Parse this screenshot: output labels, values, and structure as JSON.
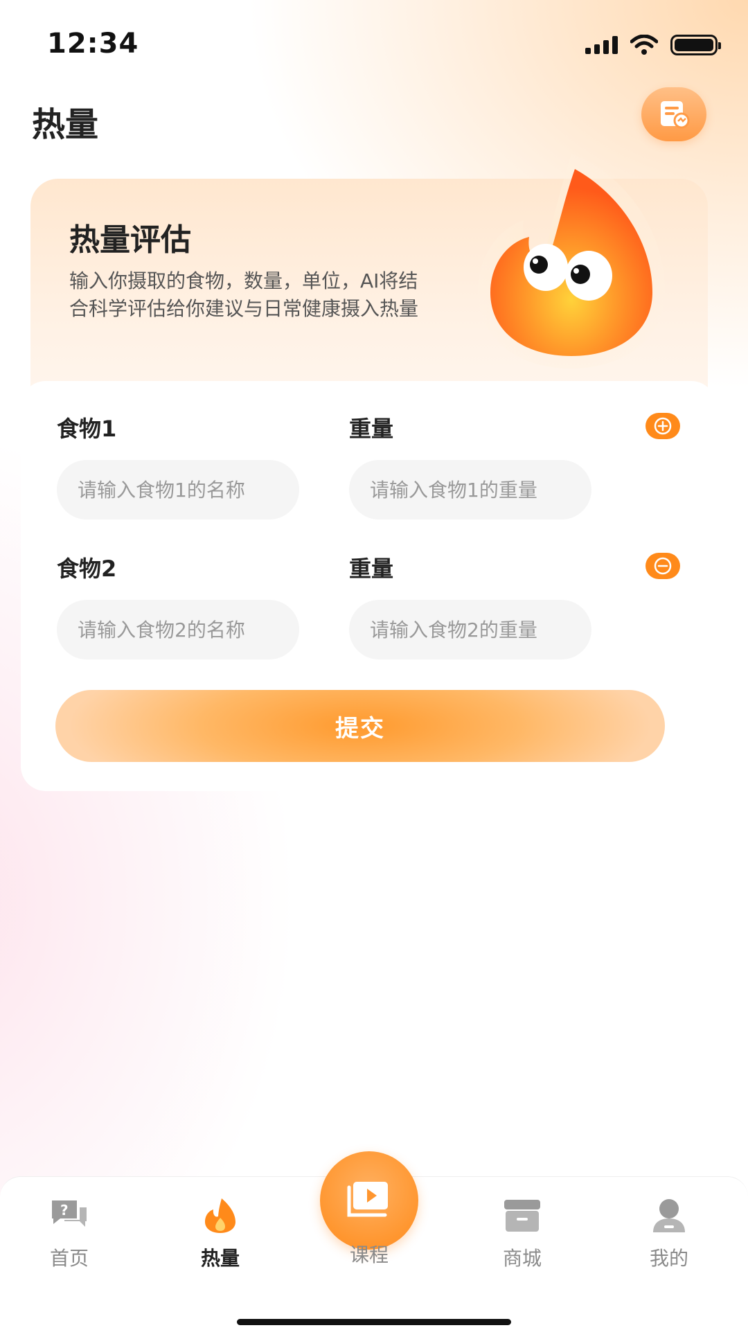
{
  "status_bar": {
    "time": "12:34"
  },
  "header": {
    "title": "热量"
  },
  "hero": {
    "title": "热量评估",
    "description": "输入你摄取的食物，数量，单位，AI将结合科学评估给你建议与日常健康摄入热量"
  },
  "form": {
    "rows": [
      {
        "food_label": "食物1",
        "weight_label": "重量",
        "food_placeholder": "请输入食物1的名称",
        "weight_placeholder": "请输入食物1的重量",
        "action": "add-icon"
      },
      {
        "food_label": "食物2",
        "weight_label": "重量",
        "food_placeholder": "请输入食物2的名称",
        "weight_placeholder": "请输入食物2的重量",
        "action": "remove-icon"
      }
    ],
    "submit_label": "提交"
  },
  "tabbar": {
    "items": [
      {
        "label": "首页",
        "icon": "qa-chat-icon"
      },
      {
        "label": "热量",
        "icon": "flame-icon",
        "active": true
      },
      {
        "label": "课程",
        "icon": "video-course-icon"
      },
      {
        "label": "商城",
        "icon": "store-icon"
      },
      {
        "label": "我的",
        "icon": "user-icon"
      }
    ]
  },
  "colors": {
    "accent": "#ff8a1a",
    "accent_light": "#ffb866",
    "text": "#222222",
    "muted": "#8a8a8a"
  }
}
